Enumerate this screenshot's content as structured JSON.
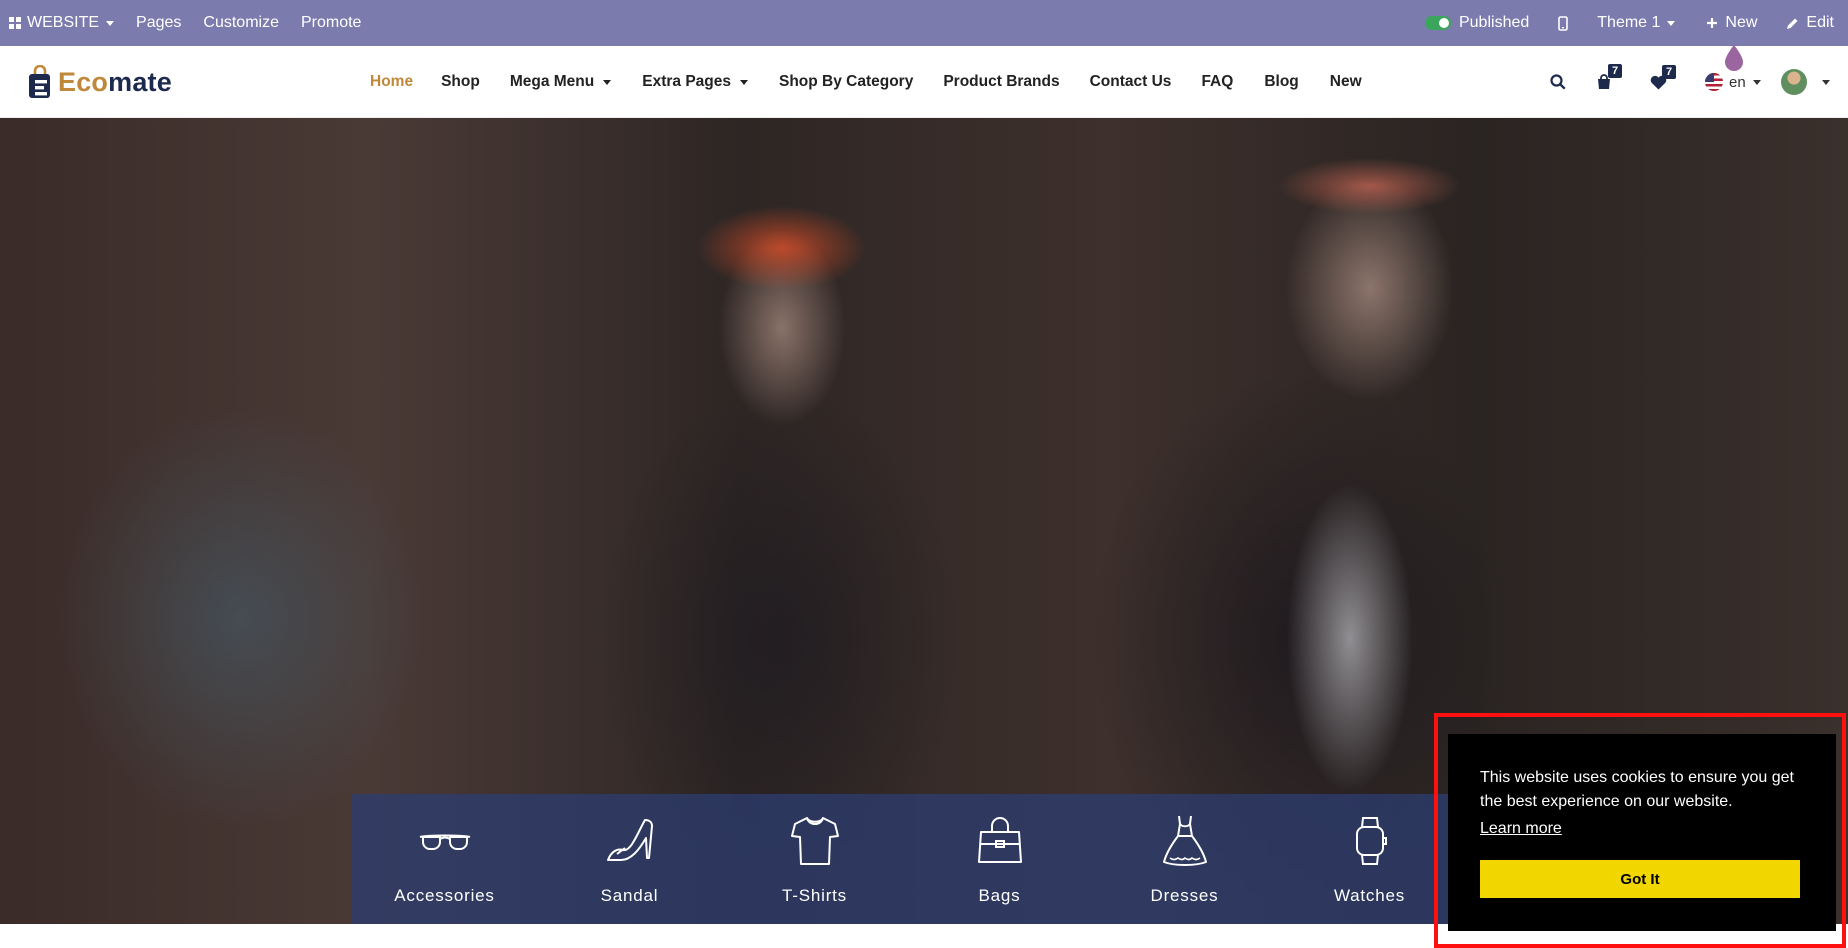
{
  "admin_bar": {
    "website_label": "WEBSITE",
    "pages_label": "Pages",
    "customize_label": "Customize",
    "promote_label": "Promote",
    "published_label": "Published",
    "theme_label": "Theme 1",
    "new_label": "New",
    "edit_label": "Edit",
    "bg_color": "#7c7bad"
  },
  "header": {
    "logo_part1": "Eco",
    "logo_part2": "mate",
    "nav": [
      {
        "label": "Home"
      },
      {
        "label": "Shop"
      },
      {
        "label": "Mega Menu"
      },
      {
        "label": "Extra Pages"
      },
      {
        "label": "Shop By Category"
      },
      {
        "label": "Product Brands"
      },
      {
        "label": "Contact Us"
      },
      {
        "label": "FAQ"
      },
      {
        "label": "Blog"
      },
      {
        "label": "New"
      }
    ],
    "cart_count": "7",
    "wishlist_count": "7",
    "language_label": "en",
    "accent_color": "#c0883a"
  },
  "categories": [
    {
      "label": "Accessories",
      "icon": "glasses-icon"
    },
    {
      "label": "Sandal",
      "icon": "high-heel-icon"
    },
    {
      "label": "T-Shirts",
      "icon": "tshirt-icon"
    },
    {
      "label": "Bags",
      "icon": "handbag-icon"
    },
    {
      "label": "Dresses",
      "icon": "dress-icon"
    },
    {
      "label": "Watches",
      "icon": "watch-icon"
    }
  ],
  "cookie": {
    "message": "This website uses cookies to ensure you get the best experience on our website.",
    "learn_more": "Learn more",
    "button": "Got It",
    "button_color": "#f1d600"
  }
}
